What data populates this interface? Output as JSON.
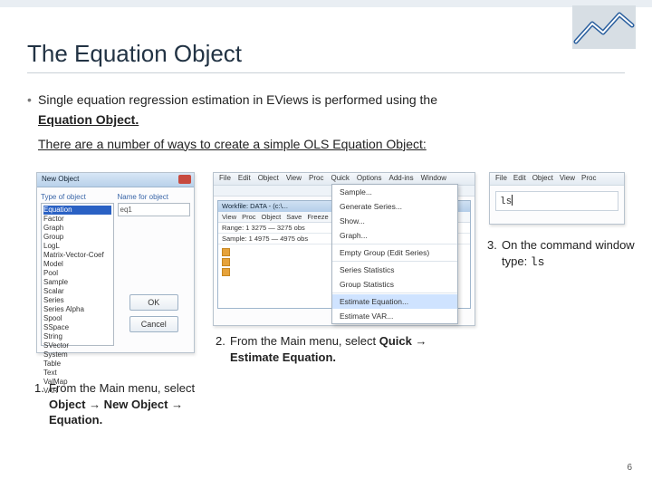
{
  "title": "The Equation Object",
  "bullet": {
    "line1": "Single equation regression estimation in EViews is performed using the",
    "eqobj": "Equation Object.",
    "ways": "There are a number of ways to create a simple OLS Equation Object:"
  },
  "panel1": {
    "title": "New Object",
    "type_label": "Type of object",
    "name_label": "Name for object",
    "name_value": "eq1",
    "items": [
      "Equation",
      "Factor",
      "Graph",
      "Group",
      "LogL",
      "Matrix-Vector-Coef",
      "Model",
      "Pool",
      "Sample",
      "Scalar",
      "Series",
      "Series Alpha",
      "Spool",
      "SSpace",
      "String",
      "SVector",
      "System",
      "Table",
      "Text",
      "ValMap",
      "VAR"
    ],
    "ok": "OK",
    "cancel": "Cancel"
  },
  "panel2": {
    "menu_items": [
      "File",
      "Edit",
      "Object",
      "View",
      "Proc",
      "Quick",
      "Options",
      "Add-ins",
      "Window"
    ],
    "wf_title": "Workfile: DATA - (c:\\...",
    "tools": [
      "View",
      "Proc",
      "Object",
      "Save",
      "Freeze"
    ],
    "range": "Range: 1 3275 — 3275 obs",
    "sample": "Sample: 1 4975 — 4975 obs",
    "quick_menu": [
      "Sample...",
      "Generate Series...",
      "Show...",
      "Graph...",
      "Empty Group (Edit Series)",
      "Series Statistics",
      "Group Statistics",
      "Estimate Equation...",
      "Estimate VAR..."
    ]
  },
  "panel3": {
    "menu_items": [
      "File",
      "Edit",
      "Object",
      "View",
      "Proc"
    ],
    "cmd": "ls"
  },
  "captions": {
    "c1_num": "1.",
    "c1a": "From the Main menu, select ",
    "c1b": "Object → New Object → Equation.",
    "c2_num": "2.",
    "c2a": "From the Main menu, select ",
    "c2b": "Quick → Estimate Equation.",
    "c3_num": "3.",
    "c3a": "On the command window type: ",
    "c3b": "ls"
  },
  "page_number": "6"
}
